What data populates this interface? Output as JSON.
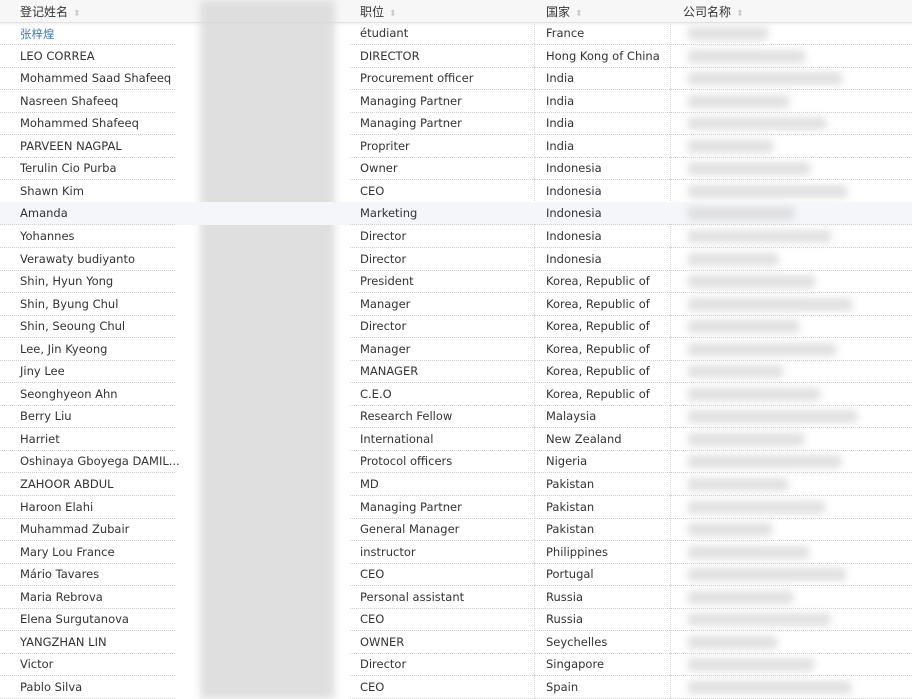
{
  "headers": {
    "name": "登记姓名",
    "hidden": "",
    "title": "职位",
    "country": "国家",
    "company": "公司名称"
  },
  "sort_icon": "sort-updown-icon",
  "colors": {
    "link": "#4a79b0",
    "header_bg": "#f7f7f7",
    "highlight": "#f4f6f9"
  },
  "rows": [
    {
      "name": "张梓煌",
      "title": "étudiant",
      "country": "France"
    },
    {
      "name": "LEO CORREA",
      "title": "DIRECTOR",
      "country": "Hong Kong of China"
    },
    {
      "name": "Mohammed Saad Shafeeq",
      "title": "Procurement officer",
      "country": "India"
    },
    {
      "name": "Nasreen Shafeeq",
      "title": "Managing Partner",
      "country": "India"
    },
    {
      "name": "Mohammed Shafeeq",
      "title": "Managing Partner",
      "country": "India"
    },
    {
      "name": "PARVEEN NAGPAL",
      "title": "Propriter",
      "country": "India"
    },
    {
      "name": "Terulin Cio Purba",
      "title": "Owner",
      "country": "Indonesia"
    },
    {
      "name": "Shawn Kim",
      "title": "CEO",
      "country": "Indonesia"
    },
    {
      "name": "Amanda",
      "title": "Marketing",
      "country": "Indonesia"
    },
    {
      "name": "Yohannes",
      "title": "Director",
      "country": "Indonesia"
    },
    {
      "name": "Verawaty budiyanto",
      "title": "Director",
      "country": "Indonesia"
    },
    {
      "name": "Shin, Hyun Yong",
      "title": "President",
      "country": "Korea, Republic of"
    },
    {
      "name": "Shin, Byung Chul",
      "title": "Manager",
      "country": "Korea, Republic of"
    },
    {
      "name": "Shin, Seoung Chul",
      "title": "Director",
      "country": "Korea, Republic of"
    },
    {
      "name": "Lee, Jin Kyeong",
      "title": "Manager",
      "country": "Korea, Republic of"
    },
    {
      "name": "Jiny Lee",
      "title": "MANAGER",
      "country": "Korea, Republic of"
    },
    {
      "name": "Seonghyeon Ahn",
      "title": "C.E.O",
      "country": "Korea, Republic of"
    },
    {
      "name": "Berry Liu",
      "title": "Research Fellow",
      "country": "Malaysia"
    },
    {
      "name": "Harriet",
      "title": "International",
      "country": "New Zealand"
    },
    {
      "name": "Oshinaya Gboyega DAMIL...",
      "title": "Protocol officers",
      "country": "Nigeria"
    },
    {
      "name": "ZAHOOR ABDUL",
      "title": "MD",
      "country": "Pakistan"
    },
    {
      "name": "Haroon Elahi",
      "title": "Managing Partner",
      "country": "Pakistan"
    },
    {
      "name": "Muhammad Zubair",
      "title": "General Manager",
      "country": "Pakistan"
    },
    {
      "name": "Mary Lou France",
      "title": "instructor",
      "country": "Philippines"
    },
    {
      "name": "Mário Tavares",
      "title": "CEO",
      "country": "Portugal"
    },
    {
      "name": "Maria Rebrova",
      "title": "Personal assistant",
      "country": "Russia"
    },
    {
      "name": "Elena Surgutanova",
      "title": "CEO",
      "country": "Russia"
    },
    {
      "name": "YANGZHAN LIN",
      "title": "OWNER",
      "country": "Seychelles"
    },
    {
      "name": "Victor",
      "title": "Director",
      "country": "Singapore"
    },
    {
      "name": "Pablo Silva",
      "title": "CEO",
      "country": "Spain"
    }
  ]
}
